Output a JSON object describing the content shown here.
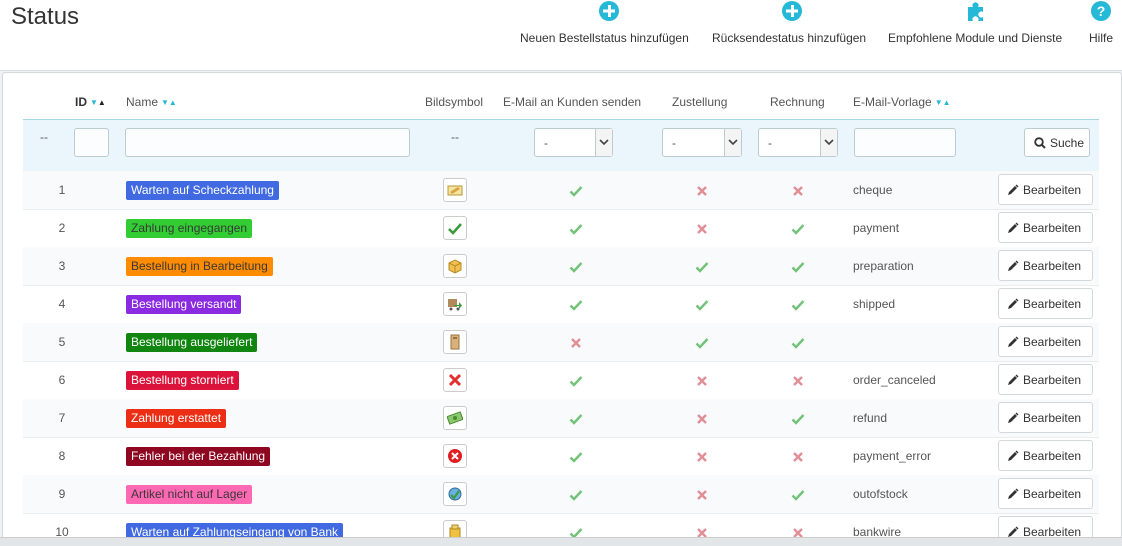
{
  "page": {
    "title": "Status"
  },
  "toolbar": {
    "add_order_status": "Neuen Bestellstatus hinzufügen",
    "add_return_status": "Rücksendestatus hinzufügen",
    "recommended_modules": "Empfohlene Module und Dienste",
    "help": "Hilfe",
    "icon_color": "#25b9d7"
  },
  "table": {
    "headers": {
      "id": "ID",
      "name": "Name",
      "icon": "Bildsymbol",
      "send_email": "E-Mail an Kunden senden",
      "delivery": "Zustellung",
      "invoice": "Rechnung",
      "template": "E-Mail-Vorlage"
    },
    "filters": {
      "bulk": "--",
      "icon": "--",
      "send_email": "-",
      "delivery": "-",
      "invoice": "-",
      "search_label": "Suche"
    },
    "edit_label": "Bearbeiten",
    "rows": [
      {
        "id": "1",
        "name": "Warten auf Scheckzahlung",
        "color": "#4169e1",
        "text_color": "#ffffff",
        "icon": "cheque-icon",
        "send_email": true,
        "delivery": false,
        "invoice": false,
        "template": "cheque"
      },
      {
        "id": "2",
        "name": "Zahlung eingegangen",
        "color": "#32cd32",
        "text_color": "#383838",
        "icon": "check-icon",
        "send_email": true,
        "delivery": false,
        "invoice": true,
        "template": "payment"
      },
      {
        "id": "3",
        "name": "Bestellung in Bearbeitung",
        "color": "#ff8c00",
        "text_color": "#383838",
        "icon": "package-icon",
        "send_email": true,
        "delivery": true,
        "invoice": true,
        "template": "preparation"
      },
      {
        "id": "4",
        "name": "Bestellung versandt",
        "color": "#8a2be2",
        "text_color": "#ffffff",
        "icon": "truck-icon",
        "send_email": true,
        "delivery": true,
        "invoice": true,
        "template": "shipped"
      },
      {
        "id": "5",
        "name": "Bestellung ausgeliefert",
        "color": "#108510",
        "text_color": "#ffffff",
        "icon": "delivered-box-icon",
        "send_email": false,
        "delivery": true,
        "invoice": true,
        "template": ""
      },
      {
        "id": "6",
        "name": "Bestellung storniert",
        "color": "#dc143c",
        "text_color": "#ffffff",
        "icon": "cancel-icon",
        "send_email": true,
        "delivery": false,
        "invoice": false,
        "template": "order_canceled"
      },
      {
        "id": "7",
        "name": "Zahlung erstattet",
        "color": "#ec2e15",
        "text_color": "#ffffff",
        "icon": "money-icon",
        "send_email": true,
        "delivery": false,
        "invoice": true,
        "template": "refund"
      },
      {
        "id": "8",
        "name": "Fehler bei der Bezahlung",
        "color": "#8f0621",
        "text_color": "#ffffff",
        "icon": "error-icon",
        "send_email": true,
        "delivery": false,
        "invoice": false,
        "template": "payment_error"
      },
      {
        "id": "9",
        "name": "Artikel nicht auf Lager",
        "color": "#ff69b4",
        "text_color": "#383838",
        "icon": "out-of-stock-icon",
        "send_email": true,
        "delivery": false,
        "invoice": true,
        "template": "outofstock"
      },
      {
        "id": "10",
        "name": "Warten auf Zahlungseingang von Bank",
        "color": "#4169e1",
        "text_color": "#ffffff",
        "icon": "bank-icon",
        "send_email": true,
        "delivery": false,
        "invoice": false,
        "template": "bankwire"
      }
    ]
  },
  "colors": {
    "check": "#72c279",
    "cross": "#e08f95",
    "accent": "#25b9d7"
  }
}
